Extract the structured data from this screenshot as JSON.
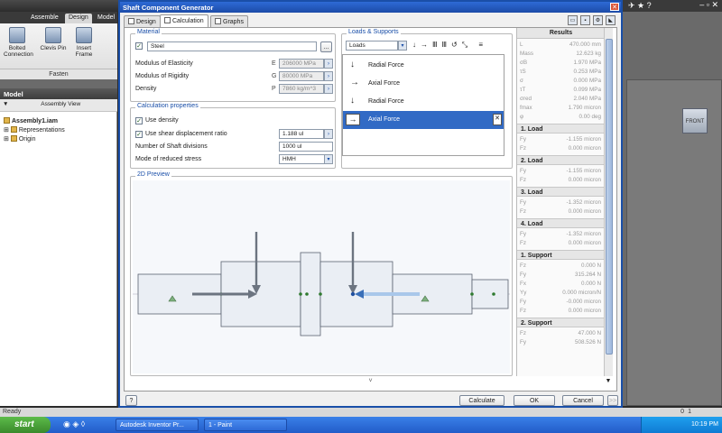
{
  "inventor": {
    "tabs": [
      "Assemble",
      "Design",
      "Model"
    ],
    "ribbon_buttons": [
      "Bolted Connection",
      "Clevis Pin",
      "Insert Frame"
    ],
    "ribbon_group": "Fasten",
    "model_panel_title": "Model",
    "view_selector": "Assembly View",
    "tree": [
      "Assembly1.iam",
      "Representations",
      "Origin"
    ],
    "viewcube_label": "FRONT"
  },
  "dialog": {
    "title": "Shaft Component Generator",
    "close_glyph": "✕",
    "tabs": [
      "Design",
      "Calculation",
      "Graphs"
    ],
    "active_tab": "Calculation",
    "material": {
      "legend": "Material",
      "name": "Steel",
      "browse": "...",
      "rows": [
        {
          "label": "Modulus of Elasticity",
          "sym": "E",
          "value": "206000 MPa"
        },
        {
          "label": "Modulus of Rigidity",
          "sym": "G",
          "value": "80000 MPa"
        },
        {
          "label": "Density",
          "sym": "P",
          "value": "7860 kg/m^3"
        }
      ]
    },
    "calc_props": {
      "legend": "Calculation properties",
      "use_density": "Use density",
      "use_shear": "Use shear displacement ratio",
      "shear_value": "1.188 ul",
      "divisions_label": "Number of Shaft divisions",
      "divisions_value": "1000 ul",
      "mode_label": "Mode of reduced stress",
      "mode_value": "HMH"
    },
    "loads": {
      "legend": "Loads & Supports",
      "dropdown": "Loads",
      "items": [
        {
          "arrow": "↓",
          "label": "Radial Force"
        },
        {
          "arrow": "→",
          "label": "Axial Force"
        },
        {
          "arrow": "↓",
          "label": "Radial Force"
        },
        {
          "arrow": "→",
          "label": "Axial Force"
        }
      ]
    },
    "preview_legend": "2D Preview",
    "results": {
      "title": "Results",
      "summary": [
        {
          "k": "L",
          "v": "470.000 mm"
        },
        {
          "k": "Mass",
          "v": "12.623 kg"
        },
        {
          "k": "σB",
          "v": "1.970 MPa"
        },
        {
          "k": "τS",
          "v": "0.253 MPa"
        },
        {
          "k": "σ",
          "v": "0.000 MPa"
        },
        {
          "k": "τT",
          "v": "0.099 MPa"
        },
        {
          "k": "σred",
          "v": "2.040 MPa"
        },
        {
          "k": "fmax",
          "v": "1.790 micron"
        },
        {
          "k": "φ",
          "v": "0.00 deg"
        }
      ],
      "sections": [
        {
          "title": "1. Load",
          "rows": [
            {
              "k": "Fy",
              "v": "-1.155 micron"
            },
            {
              "k": "Fz",
              "v": "0.000 micron"
            }
          ]
        },
        {
          "title": "2. Load",
          "rows": [
            {
              "k": "Fy",
              "v": "-1.155 micron"
            },
            {
              "k": "Fz",
              "v": "0.000 micron"
            }
          ]
        },
        {
          "title": "3. Load",
          "rows": [
            {
              "k": "Fy",
              "v": "-1.352 micron"
            },
            {
              "k": "Fz",
              "v": "0.000 micron"
            }
          ]
        },
        {
          "title": "4. Load",
          "rows": [
            {
              "k": "Fy",
              "v": "-1.352 micron"
            },
            {
              "k": "Fz",
              "v": "0.000 micron"
            }
          ]
        },
        {
          "title": "1. Support",
          "rows": [
            {
              "k": "Fz",
              "v": "0.000 N"
            },
            {
              "k": "Fy",
              "v": "315.264 N"
            },
            {
              "k": "Fx",
              "v": "0.000 N"
            },
            {
              "k": "Yy",
              "v": "0.000 micron/N"
            },
            {
              "k": "Fy",
              "v": "-0.000 micron"
            },
            {
              "k": "Fz",
              "v": "0.000 micron"
            }
          ]
        },
        {
          "title": "2. Support",
          "rows": [
            {
              "k": "Fz",
              "v": "47.000 N"
            },
            {
              "k": "Fy",
              "v": "508.526 N"
            }
          ]
        }
      ]
    },
    "buttons": {
      "help": "?",
      "calculate": "Calculate",
      "ok": "OK",
      "cancel": "Cancel",
      "more": ">>"
    }
  },
  "status": {
    "left": "Ready",
    "page": "0",
    "page2": "1"
  },
  "taskbar": {
    "start": "start",
    "tasks": [
      "Autodesk Inventor Pr...",
      "1 - Paint"
    ],
    "time": "10:19 PM"
  }
}
